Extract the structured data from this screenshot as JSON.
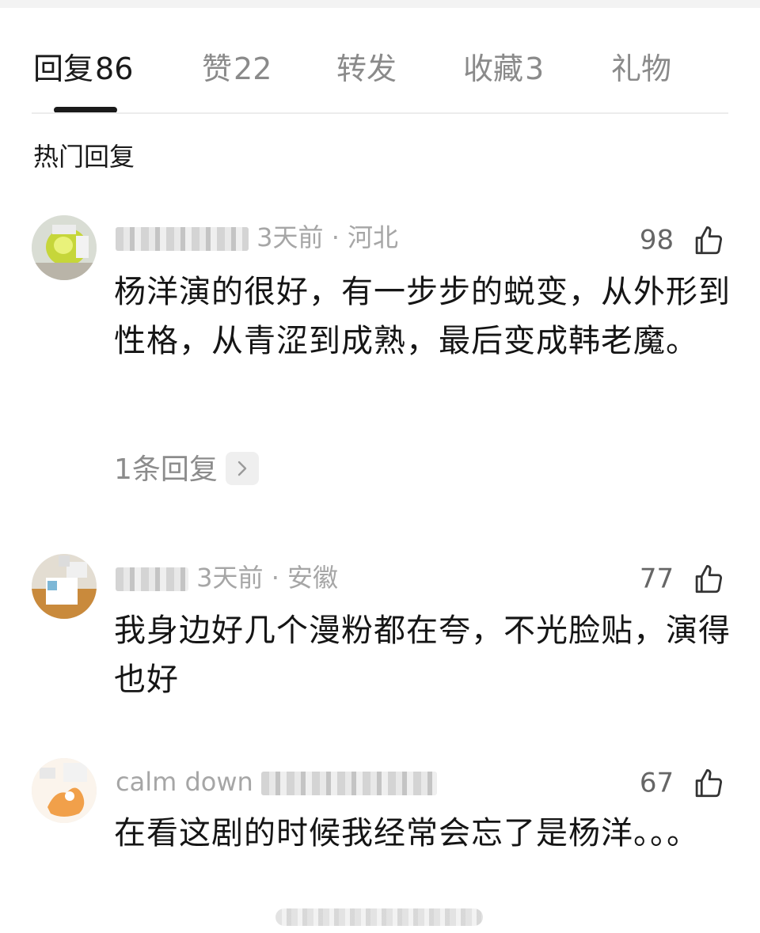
{
  "tabs": [
    {
      "label": "回复",
      "count": "86"
    },
    {
      "label": "赞",
      "count": "22"
    },
    {
      "label": "转发",
      "count": ""
    },
    {
      "label": "收藏",
      "count": "3"
    },
    {
      "label": "礼物",
      "count": ""
    }
  ],
  "section_title": "热门回复",
  "comments": [
    {
      "meta_visible": "3天前 · 河北",
      "likes": "98",
      "text": "杨洋演的很好，有一步步的蜕变，从外形到性格，从青涩到成熟，最后变成韩老魔。",
      "replies_link": "1条回复"
    },
    {
      "meta_visible": "3天前 · 安徽",
      "likes": "77",
      "text": "我身边好几个漫粉都在夸，不光脸贴，演得也好"
    },
    {
      "meta_visible": "calm down",
      "likes": "67",
      "text": "在看这剧的时候我经常会忘了是杨洋。。。"
    }
  ],
  "colors": {
    "active_tab": "#1a1a1a",
    "inactive_tab": "#8a8a8a",
    "meta": "#a6a6a6",
    "body": "#151515"
  },
  "icons": {
    "like": "thumbs-up-icon",
    "chevron": "chevron-right-icon"
  }
}
